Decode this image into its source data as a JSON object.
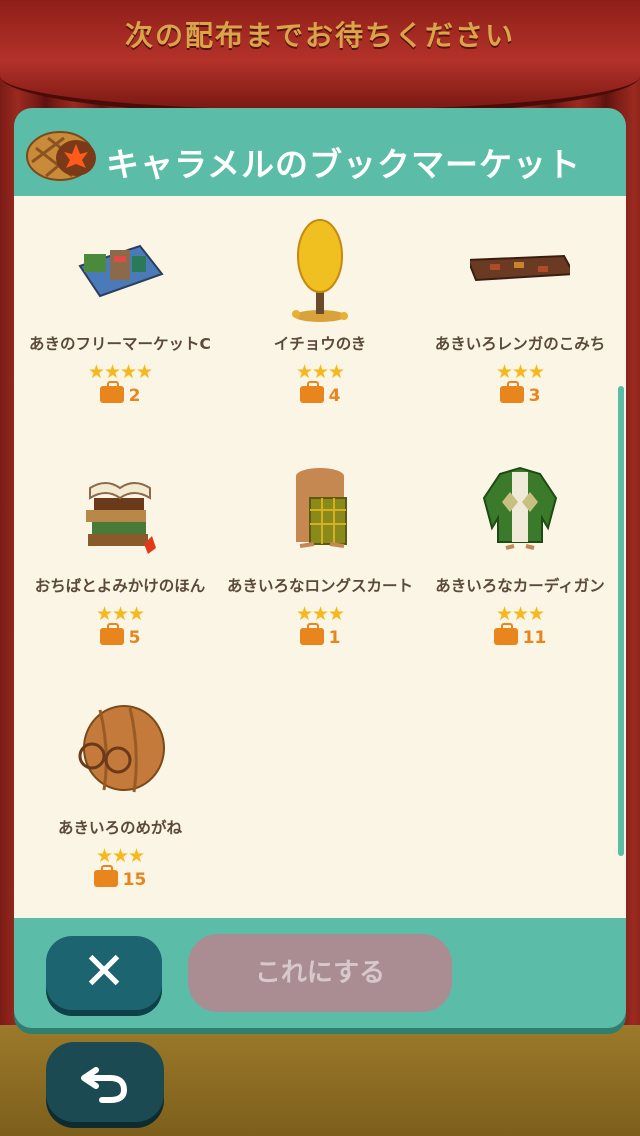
{
  "banner": {
    "text": "次の配布までお待ちください"
  },
  "modal": {
    "title": "キャラメルのブックマーケット",
    "items": [
      {
        "name": "あきのフリーマーケットC",
        "stars": "★★★★",
        "stock": "2",
        "icon": "flea-market-icon"
      },
      {
        "name": "イチョウのき",
        "stars": "★★★",
        "stock": "4",
        "icon": "ginkgo-tree-icon"
      },
      {
        "name": "あきいろレンガのこみち",
        "stars": "★★★",
        "stock": "3",
        "icon": "brick-path-icon"
      },
      {
        "name": "おちばとよみかけのほん",
        "stars": "★★★",
        "stock": "5",
        "icon": "book-stack-icon"
      },
      {
        "name": "あきいろなロングスカート",
        "stars": "★★★",
        "stock": "1",
        "icon": "long-skirt-icon"
      },
      {
        "name": "あきいろなカーディガン",
        "stars": "★★★",
        "stock": "11",
        "icon": "cardigan-icon"
      },
      {
        "name": "あきいろのめがね",
        "stars": "★★★",
        "stock": "15",
        "icon": "glasses-icon"
      }
    ],
    "footer": {
      "close_label": "✕",
      "confirm_label": "これにする"
    }
  },
  "colors": {
    "modal_accent": "#5bbda7",
    "star": "#f6b81c",
    "stock": "#e8851c",
    "close_button": "#1c6470",
    "confirm_button_disabled": "#a98d92"
  },
  "back_button": {
    "icon": "back-arrow-icon"
  }
}
